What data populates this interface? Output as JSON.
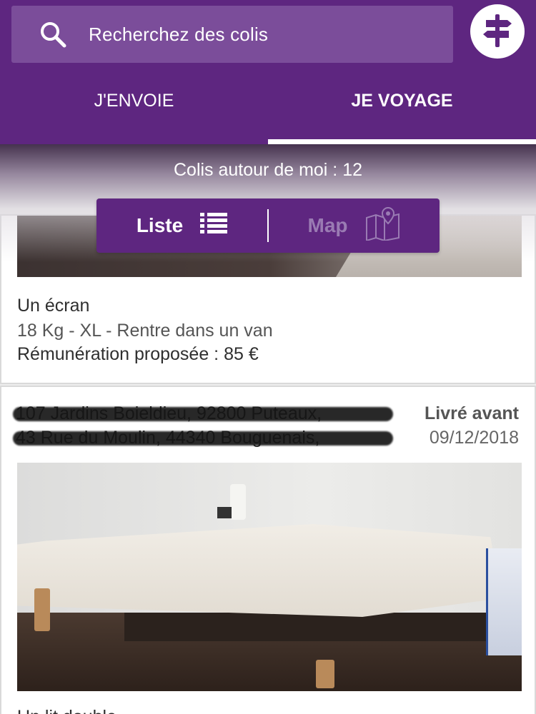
{
  "search": {
    "placeholder": "Recherchez des colis"
  },
  "tabs": [
    {
      "label": "J'ENVOIE",
      "active": false
    },
    {
      "label": "JE VOYAGE",
      "active": true
    }
  ],
  "summary": {
    "count_text": "Colis autour de moi : 12"
  },
  "view_toggle": {
    "list_label": "Liste",
    "map_label": "Map",
    "selected": "Liste"
  },
  "colors": {
    "brand": "#5e2680",
    "search_bg": "#7b4d9a"
  },
  "cards": [
    {
      "title": "Un écran",
      "details": "18 Kg - XL - Rentre dans un van",
      "price": "Rémunération proposée : 85 €"
    },
    {
      "address_from": "107 Jardins Boieldieu, 92800 Puteaux,",
      "address_to": "43 Rue du Moulin, 44340 Bouguenais,",
      "delivered_label": "Livré avant",
      "delivered_date": "09/12/2018",
      "title": "Un lit double"
    }
  ],
  "icons": {
    "search": "search-icon",
    "signpost": "signpost-icon",
    "list": "list-icon",
    "map": "map-pin-icon"
  }
}
